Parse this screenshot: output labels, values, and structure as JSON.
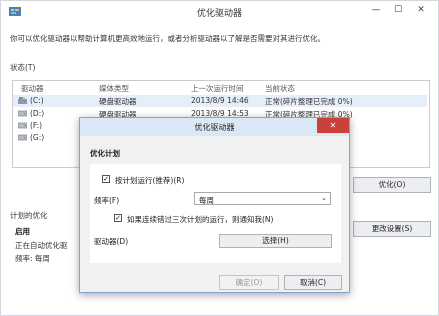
{
  "window": {
    "title": "优化驱动器",
    "controls": {
      "minimize": "—",
      "maximize": "☐",
      "close": "✕"
    }
  },
  "intro": "你可以优化驱动器以帮助计算机更高效地运行，或者分析驱动器以了解是否需要对其进行优化。",
  "status_label": "状态(T)",
  "drive_table": {
    "columns": [
      "驱动器",
      "媒体类型",
      "上一次运行时间",
      "当前状态"
    ],
    "rows": [
      {
        "name": "(C:)",
        "type": "硬盘驱动器",
        "last_run": "2013/8/9 14:46",
        "status": "正常(碎片整理已完成 0%)"
      },
      {
        "name": "(D:)",
        "type": "硬盘驱动器",
        "last_run": "2013/8/9 14:53",
        "status": "正常(碎片整理已完成 0%)"
      },
      {
        "name": "(F:)",
        "type": "",
        "last_run": "",
        "status": ""
      },
      {
        "name": "(G:)",
        "type": "",
        "last_run": "",
        "status": ""
      }
    ]
  },
  "buttons": {
    "optimize": "优化(O)",
    "change_settings": "更改设置(S)"
  },
  "schedule": {
    "title": "计划的优化",
    "state": "启用",
    "line1": "正在自动优化驱",
    "line2": "频率: 每周"
  },
  "dialog": {
    "title": "优化驱动器",
    "close": "✕",
    "heading": "优化计划",
    "run_on_schedule": {
      "label": "按计划运行(推荐)(R)",
      "checked": "✓"
    },
    "frequency_label": "频率(F)",
    "frequency_value": "每周",
    "notify": {
      "label": "如果连续错过三次计划的运行，则通知我(N)",
      "checked": "✓"
    },
    "drives_label": "驱动器(D)",
    "choose_button": "选择(H)",
    "ok_button": "确定(O)",
    "cancel_button": "取消(C)"
  },
  "colors": {
    "dialog_titlebar": "#dae7f5",
    "dialog_close": "#c9413a",
    "selected_row": "#e5eef9",
    "window_border": "#d4d8de"
  }
}
